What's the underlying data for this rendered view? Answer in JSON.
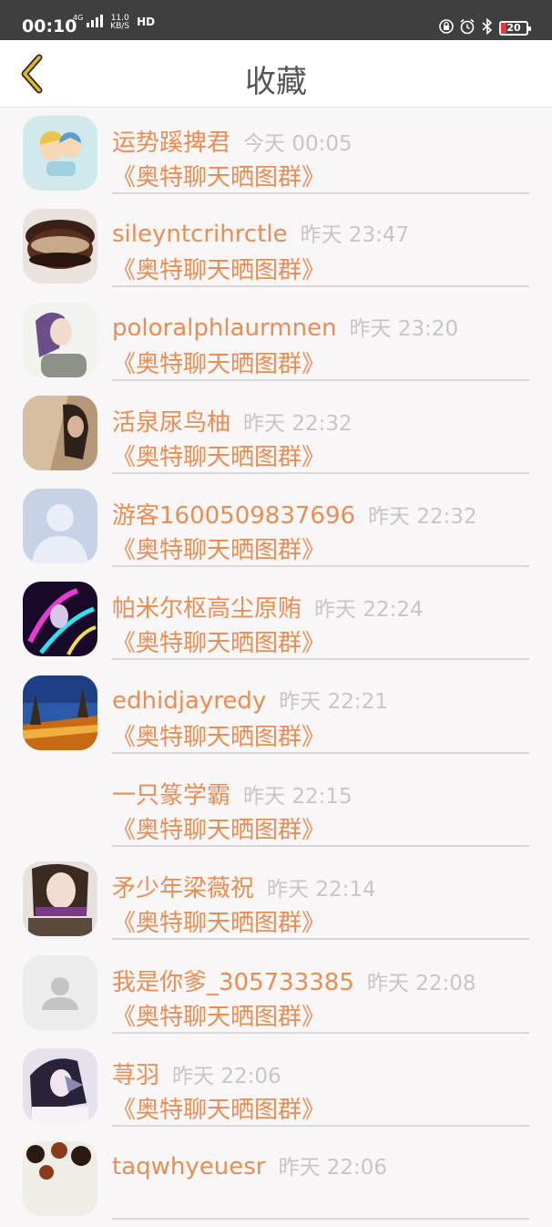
{
  "status": {
    "time": "00:10",
    "net_type": "4G",
    "speed_value": "11.0",
    "speed_unit": "KB/S",
    "hd": "HD",
    "battery": "20"
  },
  "header": {
    "title": "收藏"
  },
  "items": [
    {
      "name": "运势蹊捭君",
      "time": "今天 00:05",
      "group": "《奥特聊天晒图群》"
    },
    {
      "name": "sileyntcrihrctle",
      "time": "昨天 23:47",
      "group": "《奥特聊天晒图群》"
    },
    {
      "name": "poloralphlaurmnen",
      "time": "昨天 23:20",
      "group": "《奥特聊天晒图群》"
    },
    {
      "name": "活泉尿鸟柚",
      "time": "昨天 22:32",
      "group": "《奥特聊天晒图群》"
    },
    {
      "name": "游客1600509837696",
      "time": "昨天 22:32",
      "group": "《奥特聊天晒图群》"
    },
    {
      "name": "帕米尔枢高尘原贿",
      "time": "昨天 22:24",
      "group": "《奥特聊天晒图群》"
    },
    {
      "name": "edhidjayredy",
      "time": "昨天 22:21",
      "group": "《奥特聊天晒图群》"
    },
    {
      "name": "一只篆学霸",
      "time": "昨天 22:15",
      "group": "《奥特聊天晒图群》"
    },
    {
      "name": "矛少年梁薇祝",
      "time": "昨天 22:14",
      "group": "《奥特聊天晒图群》"
    },
    {
      "name": "我是你爹_305733385",
      "time": "昨天 22:08",
      "group": "《奥特聊天晒图群》"
    },
    {
      "name": "荨羽",
      "time": "昨天 22:06",
      "group": "《奥特聊天晒图群》"
    },
    {
      "name": "taqwhyeuesr",
      "time": "昨天 22:06",
      "group": ""
    }
  ],
  "colors": {
    "accent": "#e88e55",
    "timestamp": "#c9c5c5",
    "back_arrow": "#e6b527"
  }
}
